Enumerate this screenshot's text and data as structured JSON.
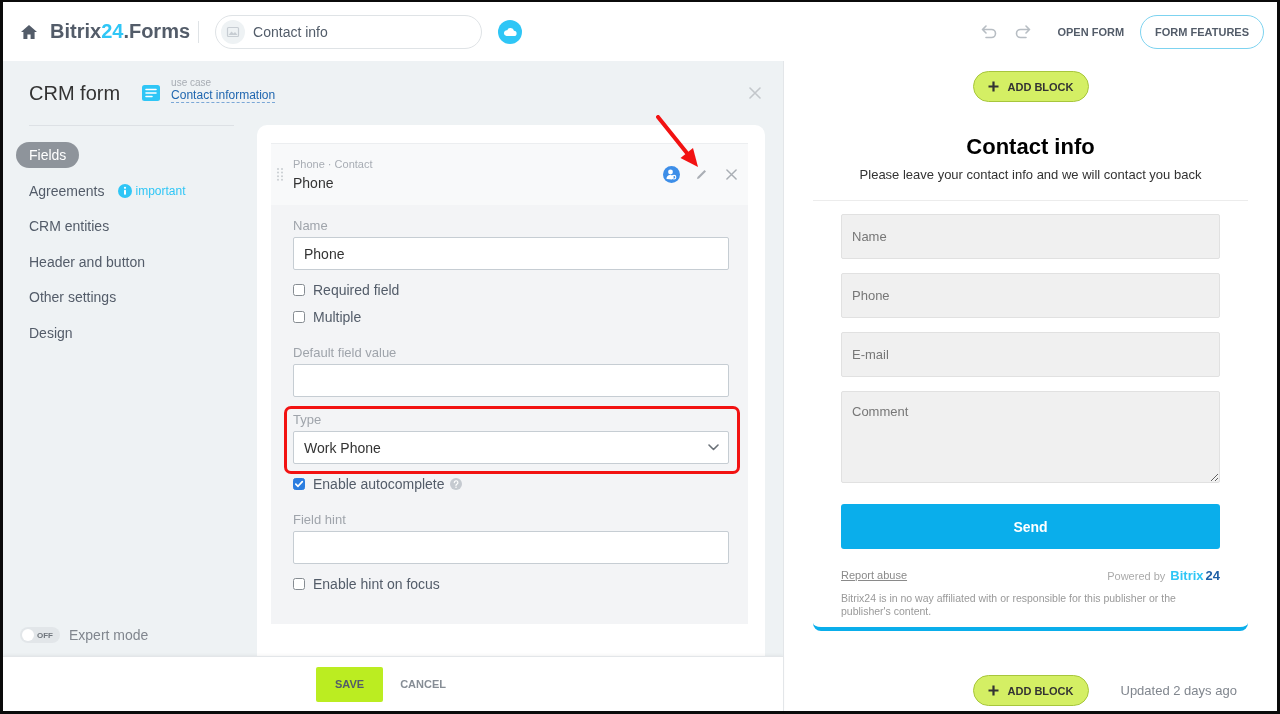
{
  "header": {
    "logo": {
      "name": "Bitrix",
      "accent": "24",
      "suffix": ".Forms"
    },
    "title_field": {
      "value": "Contact info"
    },
    "actions": [
      {
        "label": "OPEN FORM",
        "kind": "link"
      },
      {
        "label": "FORM FEATURES",
        "kind": "outlined"
      }
    ]
  },
  "editor": {
    "title": "CRM form",
    "use_case": {
      "caption": "use case",
      "link": "Contact information"
    },
    "sidebar": {
      "items": [
        {
          "label": "Fields",
          "selected": true
        },
        {
          "label": "Agreements",
          "selected": false,
          "hint": "important"
        },
        {
          "label": "CRM entities",
          "selected": false
        },
        {
          "label": "Header and button",
          "selected": false
        },
        {
          "label": "Other settings",
          "selected": false
        },
        {
          "label": "Design",
          "selected": false
        }
      ],
      "expert_mode": {
        "label": "Expert mode",
        "on": false,
        "state_text": "OFF"
      }
    },
    "field_card": {
      "subtitle": "Phone · Contact",
      "title": "Phone",
      "pointer_arrow": true,
      "settings": [
        {
          "kind": "input",
          "label": "Name",
          "value": "Phone",
          "highlighted": false
        },
        {
          "kind": "checkbox",
          "label": "Required field",
          "checked": false,
          "help": false,
          "highlighted": false
        },
        {
          "kind": "checkbox",
          "label": "Multiple",
          "checked": false,
          "help": false,
          "highlighted": false
        },
        {
          "kind": "input",
          "label": "Default field value",
          "highlighted": false
        },
        {
          "kind": "select",
          "label": "Type",
          "value": "Work Phone",
          "highlighted": true
        },
        {
          "kind": "checkbox",
          "label": "Enable autocomplete",
          "checked": true,
          "help": true,
          "highlighted": false
        },
        {
          "kind": "input",
          "label": "Field hint",
          "highlighted": false
        },
        {
          "kind": "checkbox",
          "label": "Enable hint on focus",
          "checked": false,
          "help": false,
          "highlighted": false
        }
      ]
    },
    "footer": {
      "buttons": [
        {
          "label": "SAVE",
          "kind": "primary"
        },
        {
          "label": "CANCEL",
          "kind": "link"
        }
      ]
    }
  },
  "preview": {
    "add_block_top": {
      "label": "ADD BLOCK"
    },
    "form": {
      "title": "Contact info",
      "subtitle": "Please leave your contact info and we will contact you back",
      "fields": [
        {
          "kind": "input",
          "placeholder": "Name"
        },
        {
          "kind": "input",
          "placeholder": "Phone"
        },
        {
          "kind": "input",
          "placeholder": "E-mail"
        },
        {
          "kind": "textarea",
          "placeholder": "Comment"
        }
      ],
      "submit": "Send",
      "report_link": "Report abuse",
      "powered_by": {
        "label": "Powered by",
        "brand": "Bitrix",
        "accent": "24"
      },
      "disclaimer": "Bitrix24 is in no way affiliated with or responsible for this publisher or the publisher's content."
    },
    "add_block_bottom": {
      "label": "ADD BLOCK"
    },
    "updated": "Updated 2 days ago"
  }
}
